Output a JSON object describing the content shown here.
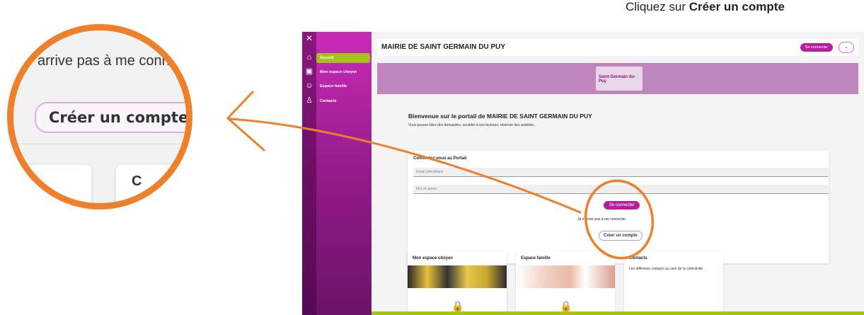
{
  "caption": {
    "prefix": "Cliquez sur ",
    "bold": "Créer un compte"
  },
  "zoom": {
    "partial_text": "arrive pas à me conne",
    "button_label": "Créer un compte",
    "partial_card_letter": "C"
  },
  "portal": {
    "title": "MAIRIE DE SAINT GERMAIN DU PUY",
    "login_button": "Se connecter",
    "dropdown_glyph": "⌄",
    "logo_text": "Saint-Germain du-Puy",
    "nav": [
      {
        "label": "Accueil",
        "icon": "home-icon",
        "active": true
      },
      {
        "label": "Mon espace citoyen",
        "icon": "id-card-icon",
        "active": false
      },
      {
        "label": "Espace famille",
        "icon": "family-icon",
        "active": false
      },
      {
        "label": "Contacts",
        "icon": "contacts-icon",
        "active": false
      }
    ],
    "welcome_title": "Bienvenue sur le portail de MAIRIE DE SAINT GERMAIN DU PUY",
    "welcome_sub": "Vous pouvez faire des demandes, accéder à vos factures, réserver des activités...",
    "login_card": {
      "title": "Connectez-vous au Portail",
      "email_placeholder": "Email (identifiant)",
      "password_placeholder": "Mot de passe",
      "submit": "Se connecter",
      "forgot": "Je n'arrive pas à me connecter",
      "create": "Créer un compte"
    },
    "tiles": [
      {
        "title": "Mon espace citoyen"
      },
      {
        "title": "Espace famille"
      },
      {
        "title": "Contacts",
        "desc": "Les différents contacts au sein de la collectivité"
      }
    ]
  },
  "colors": {
    "accent": "#b51f9e",
    "highlight": "#ee7f2b",
    "active_nav": "#a7c11a"
  }
}
